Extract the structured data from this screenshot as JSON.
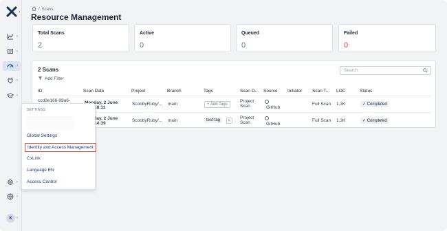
{
  "breadcrumb": {
    "home_icon": "home-icon",
    "current": "Scans"
  },
  "page_title": "Resource Management",
  "stats": [
    {
      "label": "Total Scans",
      "value": "2"
    },
    {
      "label": "Active",
      "value": "0"
    },
    {
      "label": "Queued",
      "value": "0"
    },
    {
      "label": "Failed",
      "value": "0",
      "color": "#e53935"
    }
  ],
  "scans": {
    "title": "2 Scans",
    "add_filter": "Add Filter",
    "search_placeholder": "Search",
    "columns": [
      "ID",
      "Scan Date",
      "Project",
      "Branch",
      "Tags",
      "Scan O...",
      "Source",
      "Initiator",
      "Scan T...",
      "LOC",
      "Status"
    ],
    "rows": [
      {
        "id": "ccd0e166-99a6-",
        "date_line1": "Monday, 2 June",
        "date_line2": "18:11",
        "project": "ScoobyRuby/...",
        "branch": "main",
        "tag": "+ Add Tags",
        "origin_line1": "Project",
        "origin_line2": "Scan",
        "source": "GitHub",
        "initiator": "",
        "scan_type": "Full Scan",
        "loc": "1.3K",
        "status": "Completed"
      },
      {
        "id": "",
        "date_line1": "Monday, 2 June",
        "date_line2": "14:39",
        "project": "ScoobyRuby/...",
        "branch": "main",
        "tag": "test-tag",
        "origin_line1": "Project",
        "origin_line2": "Scan",
        "source": "GitHub",
        "initiator": "",
        "scan_type": "Full Scan",
        "loc": "1.3K",
        "status": "Completed"
      }
    ]
  },
  "settings_menu": {
    "header": "SETTINGS",
    "items": [
      {
        "label": "Global Settings"
      },
      {
        "label": "Identity and Access Management",
        "highlighted": true
      },
      {
        "label": "CxLink"
      },
      {
        "label": "Language EN"
      },
      {
        "label": "Access Control"
      }
    ]
  },
  "user": {
    "initial": "K"
  },
  "colors": {
    "accent": "#1d3a8a",
    "failed": "#e53935",
    "highlight_border": "#e0503c",
    "logo": "#1f2b5c"
  }
}
